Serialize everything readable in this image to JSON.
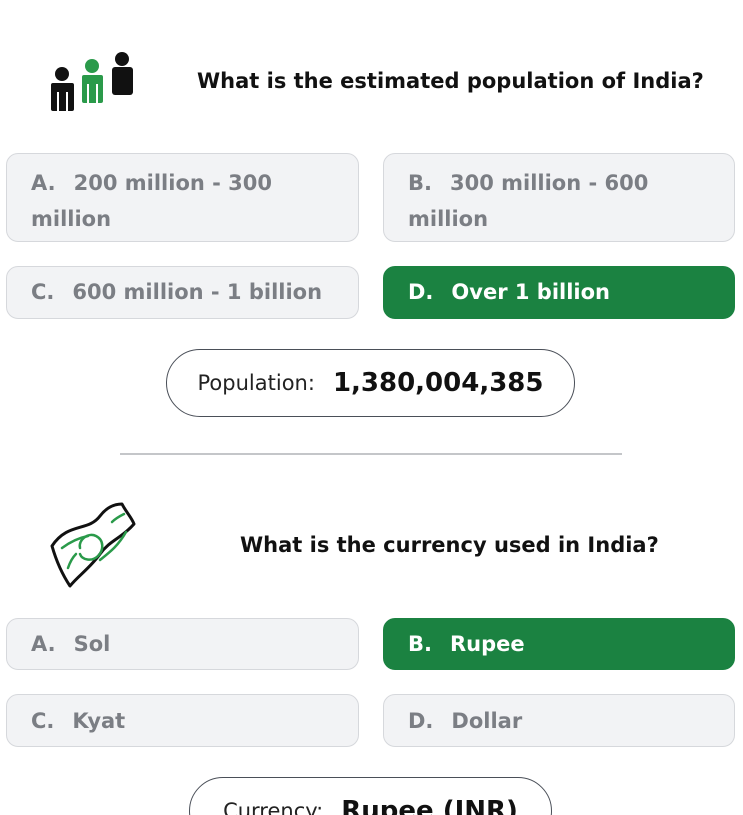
{
  "questions": [
    {
      "icon": "people-icon",
      "question": "What is the estimated population of India?",
      "options": [
        {
          "letter": "A.",
          "label": "200 million - 300 million",
          "selected": false
        },
        {
          "letter": "B.",
          "label": "300 million - 600 million",
          "selected": false
        },
        {
          "letter": "C.",
          "label": "600 million - 1 billion",
          "selected": false
        },
        {
          "letter": "D.",
          "label": "Over 1 billion",
          "selected": true
        }
      ],
      "answer": {
        "label": "Population:",
        "value": "1,380,004,385"
      }
    },
    {
      "icon": "money-bill-icon",
      "question": "What is the currency used in India?",
      "options": [
        {
          "letter": "A.",
          "label": "Sol",
          "selected": false
        },
        {
          "letter": "B.",
          "label": "Rupee",
          "selected": true
        },
        {
          "letter": "C.",
          "label": "Kyat",
          "selected": false
        },
        {
          "letter": "D.",
          "label": "Dollar",
          "selected": false
        }
      ],
      "answer": {
        "label": "Currency:",
        "value": "Rupee (INR)"
      }
    }
  ],
  "colors": {
    "selected_bg": "#1b8241",
    "option_bg": "#f2f3f5",
    "option_text": "#7b7e84",
    "icon_green": "#2a9a4a"
  }
}
